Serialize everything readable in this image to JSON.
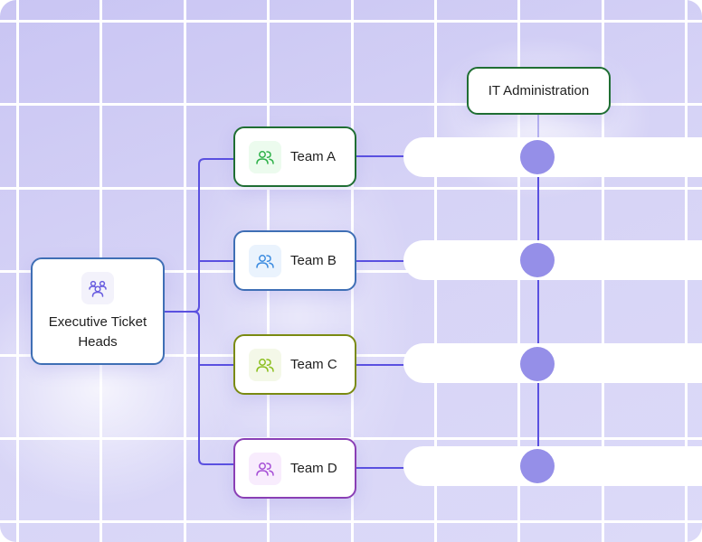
{
  "diagram": {
    "root": {
      "label": "Executive Ticket Heads",
      "icon": "group-icon",
      "border_color": "#3f6fb5",
      "icon_color": "#6a5ee0"
    },
    "teams": [
      {
        "label": "Team A",
        "icon": "users-icon",
        "border_color": "#1f6e33",
        "icon_color": "#2fb14a",
        "icon_bg": "#ecfbee"
      },
      {
        "label": "Team B",
        "icon": "users-icon",
        "border_color": "#3f6fb5",
        "icon_color": "#3d8ce0",
        "icon_bg": "#eaf3fd"
      },
      {
        "label": "Team C",
        "icon": "users-icon",
        "border_color": "#7a8a12",
        "icon_color": "#8cbf1f",
        "icon_bg": "#f4f8e8"
      },
      {
        "label": "Team D",
        "icon": "users-icon",
        "border_color": "#8a3fb5",
        "icon_color": "#a64fd6",
        "icon_bg": "#f8ecfd"
      }
    ],
    "target": {
      "label": "IT Administration",
      "border_color": "#1f6e33"
    },
    "colors": {
      "connector": "#5a50e0",
      "dot": "#958fe8",
      "background": "#d3d0f6",
      "grid": "#ffffff"
    }
  }
}
